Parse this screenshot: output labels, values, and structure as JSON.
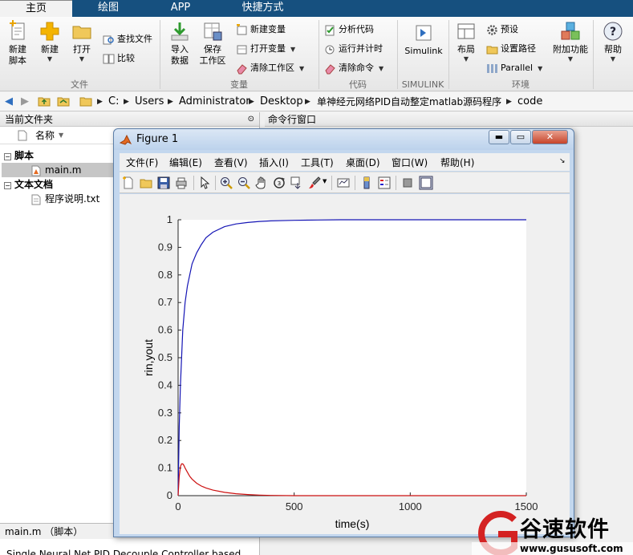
{
  "tabs": [
    "主页",
    "绘图",
    "APP",
    "快捷方式"
  ],
  "ribbon": {
    "file": {
      "new_script": [
        "新建",
        "脚本"
      ],
      "new": "新建",
      "open": "打开",
      "find_files": "查找文件",
      "compare": "比较",
      "section": "文件"
    },
    "variable": {
      "import": [
        "导入",
        "数据"
      ],
      "save_ws": [
        "保存",
        "工作区"
      ],
      "new_var": "新建变量",
      "open_var": "打开变量",
      "clear_ws": "清除工作区",
      "section": "变量"
    },
    "code": {
      "analyze": "分析代码",
      "run_time": "运行并计时",
      "clear_cmd": "清除命令",
      "section": "代码"
    },
    "simulink": {
      "label": "Simulink",
      "section": "SIMULINK"
    },
    "env": {
      "layout": "布局",
      "prefs": "预设",
      "set_path": "设置路径",
      "parallel": "Parallel",
      "addons": "附加功能",
      "section": "环境"
    },
    "help": "帮助"
  },
  "breadcrumb": [
    "C:",
    "Users",
    "Administrator",
    "Desktop",
    "单神经元网络PID自动整定matlab源码程序",
    "code"
  ],
  "file_panel": {
    "title": "当前文件夹",
    "col_name": "名称",
    "groups": [
      {
        "label": "脚本",
        "files": [
          "main.m"
        ]
      },
      {
        "label": "文本文档",
        "files": [
          "程序说明.txt"
        ]
      }
    ],
    "detail_title": "main.m （脚本）",
    "detail_text": "Single Neural Net PID Decouple Controller based"
  },
  "command_window": {
    "title": "命令行窗口"
  },
  "figure": {
    "title": "Figure 1",
    "menus": [
      "文件(F)",
      "编辑(E)",
      "查看(V)",
      "插入(I)",
      "工具(T)",
      "桌面(D)",
      "窗口(W)",
      "帮助(H)"
    ]
  },
  "chart_data": {
    "type": "line",
    "xlabel": "time(s)",
    "ylabel": "rin,yout",
    "xlim": [
      0,
      1500
    ],
    "ylim": [
      0,
      1
    ],
    "xticks": [
      0,
      500,
      1000,
      1500
    ],
    "yticks": [
      0,
      0.1,
      0.2,
      0.3,
      0.4,
      0.5,
      0.6,
      0.7,
      0.8,
      0.9,
      1
    ],
    "grid": false,
    "series": [
      {
        "color": "#1515b5",
        "x": [
          0,
          5,
          10,
          20,
          30,
          40,
          50,
          60,
          80,
          100,
          120,
          150,
          200,
          250,
          300,
          350,
          400,
          500,
          600,
          700,
          800,
          1000,
          1200,
          1500
        ],
        "y": [
          0,
          0.25,
          0.4,
          0.6,
          0.7,
          0.76,
          0.8,
          0.84,
          0.88,
          0.91,
          0.935,
          0.955,
          0.975,
          0.985,
          0.99,
          0.994,
          0.996,
          0.998,
          0.999,
          1.0,
          1.0,
          1.0,
          1.0,
          1.0
        ]
      },
      {
        "color": "#cc1010",
        "x": [
          0,
          5,
          10,
          15,
          20,
          25,
          30,
          40,
          50,
          60,
          80,
          100,
          120,
          150,
          200,
          250,
          300,
          350,
          400,
          500,
          700,
          1000,
          1500
        ],
        "y": [
          0,
          0.07,
          0.105,
          0.115,
          0.115,
          0.11,
          0.1,
          0.085,
          0.07,
          0.06,
          0.045,
          0.035,
          0.028,
          0.02,
          0.012,
          0.007,
          0.004,
          0.002,
          0.001,
          0,
          0,
          0,
          0
        ]
      }
    ]
  },
  "watermark": {
    "name": "谷速软件",
    "url": "www.gususoft.com"
  }
}
